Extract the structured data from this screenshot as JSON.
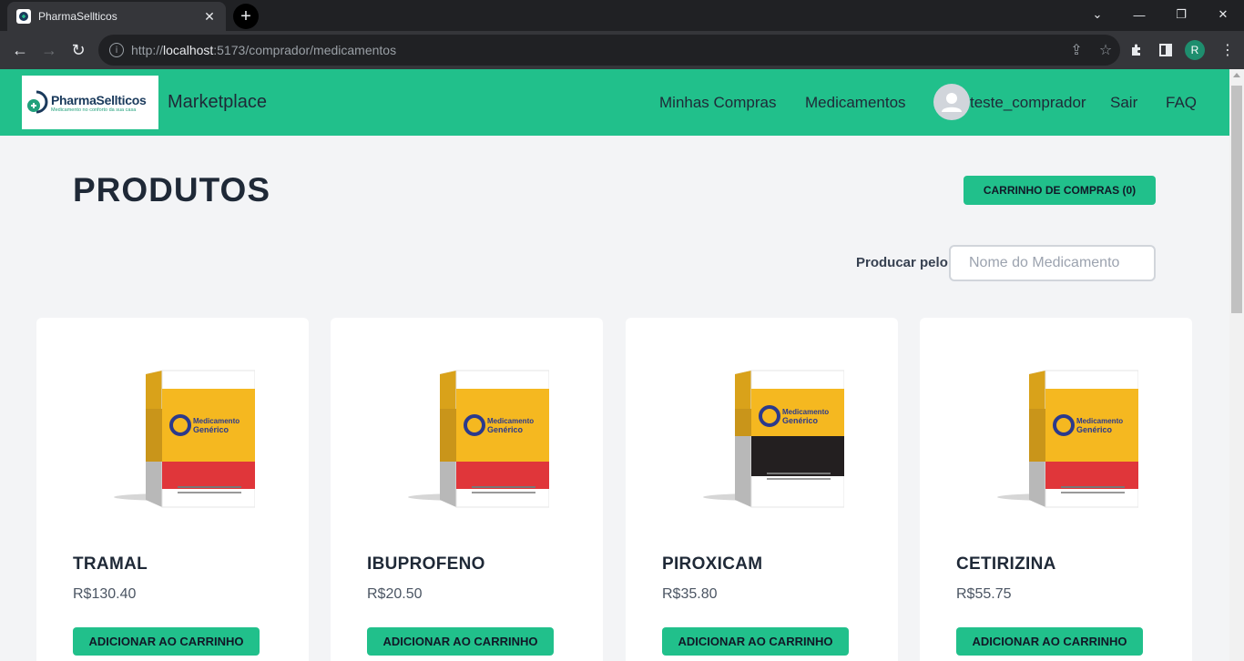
{
  "browser": {
    "tab_title": "PharmaSellticos",
    "url_host": "localhost",
    "url_prefix": "http://",
    "url_suffix": ":5173/comprador/medicamentos",
    "profile_initial": "R"
  },
  "header": {
    "logo_name": "PharmaSellticos",
    "logo_tagline": "Medicamento no conforto da sua casa",
    "brand": "Marketplace",
    "nav": {
      "compras": "Minhas Compras",
      "medicamentos": "Medicamentos",
      "user": "teste_comprador",
      "sair": "Sair",
      "faq": "FAQ"
    }
  },
  "main": {
    "title": "PRODUTOS",
    "cart_button": "CARRINHO DE COMPRAS (0)",
    "search_label": "Producar pelo:",
    "search_placeholder": "Nome do Medicamento"
  },
  "products": [
    {
      "name": "TRAMAL",
      "price": "R$130.40",
      "button": "ADICIONAR AO CARRINHO",
      "variant": "red",
      "box_line1": "Medicamento",
      "box_line2": "Genérico"
    },
    {
      "name": "IBUPROFENO",
      "price": "R$20.50",
      "button": "ADICIONAR AO CARRINHO",
      "variant": "red",
      "box_line1": "Medicamento",
      "box_line2": "Genérico"
    },
    {
      "name": "PIROXICAM",
      "price": "R$35.80",
      "button": "ADICIONAR AO CARRINHO",
      "variant": "black",
      "box_line1": "Medicamento",
      "box_line2": "Genérico"
    },
    {
      "name": "CETIRIZINA",
      "price": "R$55.75",
      "button": "ADICIONAR AO CARRINHO",
      "variant": "red",
      "box_line1": "Medicamento",
      "box_line2": "Genérico"
    }
  ],
  "colors": {
    "accent": "#21c08b",
    "box_yellow": "#f5b820",
    "box_red": "#e0363a",
    "box_black": "#231f20"
  }
}
